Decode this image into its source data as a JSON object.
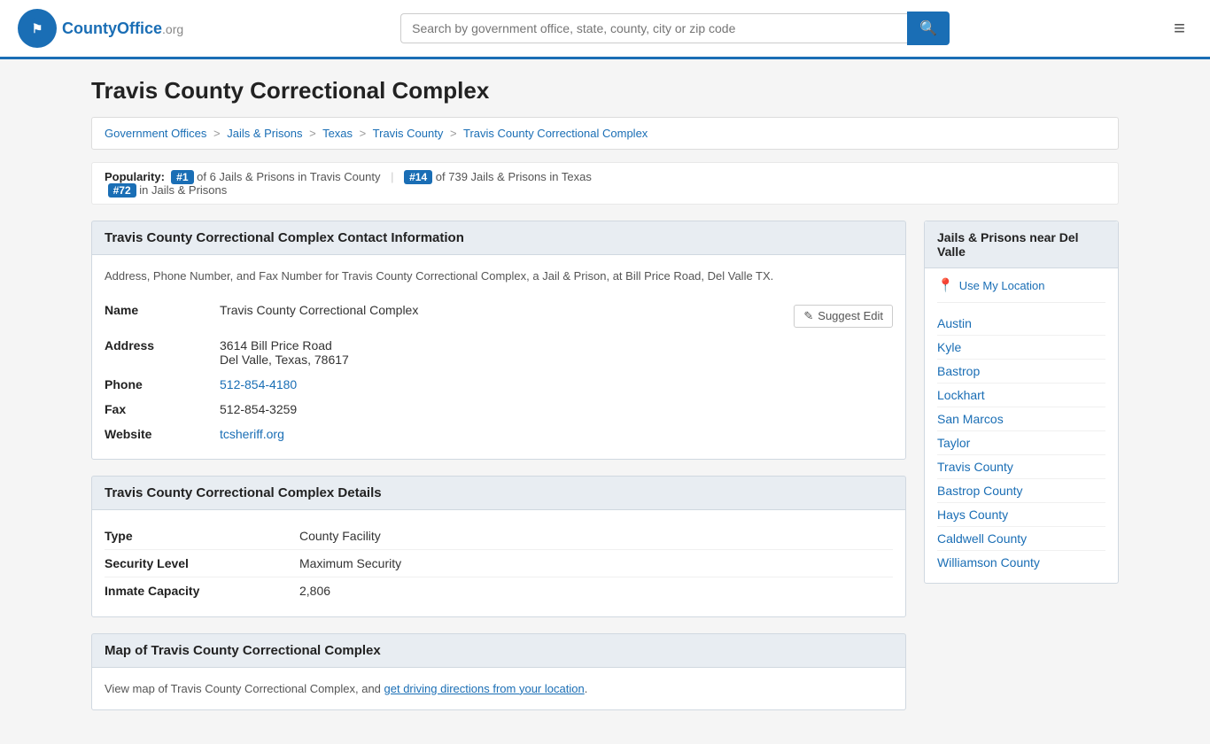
{
  "header": {
    "logo_text": "CountyOffice",
    "logo_org": ".org",
    "search_placeholder": "Search by government office, state, county, city or zip code",
    "search_icon": "🔍",
    "menu_icon": "≡"
  },
  "page": {
    "title": "Travis County Correctional Complex",
    "breadcrumb": {
      "items": [
        {
          "label": "Government Offices",
          "href": "#"
        },
        {
          "label": "Jails & Prisons",
          "href": "#"
        },
        {
          "label": "Texas",
          "href": "#"
        },
        {
          "label": "Travis County",
          "href": "#"
        },
        {
          "label": "Travis County Correctional Complex",
          "href": "#"
        }
      ]
    },
    "popularity": {
      "prefix": "Popularity:",
      "badge1": "#1",
      "of_text1": "of 6 Jails & Prisons in Travis County",
      "badge2": "#14",
      "of_text2": "of 739 Jails & Prisons in Texas",
      "badge3": "#72",
      "of_text3": "in Jails & Prisons"
    }
  },
  "contact_section": {
    "title": "Travis County Correctional Complex Contact Information",
    "description": "Address, Phone Number, and Fax Number for Travis County Correctional Complex, a Jail & Prison, at Bill Price Road, Del Valle TX.",
    "fields": {
      "name_label": "Name",
      "name_value": "Travis County Correctional Complex",
      "address_label": "Address",
      "address_line1": "3614 Bill Price Road",
      "address_line2": "Del Valle, Texas, 78617",
      "phone_label": "Phone",
      "phone_value": "512-854-4180",
      "fax_label": "Fax",
      "fax_value": "512-854-3259",
      "website_label": "Website",
      "website_value": "tcsheriff.org"
    },
    "suggest_edit": "Suggest Edit"
  },
  "details_section": {
    "title": "Travis County Correctional Complex Details",
    "fields": {
      "type_label": "Type",
      "type_value": "County Facility",
      "security_label": "Security Level",
      "security_value": "Maximum Security",
      "capacity_label": "Inmate Capacity",
      "capacity_value": "2,806"
    }
  },
  "map_section": {
    "title": "Map of Travis County Correctional Complex",
    "description": "View map of Travis County Correctional Complex, and ",
    "link_text": "get driving directions from your location",
    "description_end": "."
  },
  "sidebar": {
    "title": "Jails & Prisons near Del Valle",
    "use_location": "Use My Location",
    "links": [
      {
        "label": "Austin",
        "href": "#"
      },
      {
        "label": "Kyle",
        "href": "#"
      },
      {
        "label": "Bastrop",
        "href": "#"
      },
      {
        "label": "Lockhart",
        "href": "#"
      },
      {
        "label": "San Marcos",
        "href": "#"
      },
      {
        "label": "Taylor",
        "href": "#"
      },
      {
        "label": "Travis County",
        "href": "#"
      },
      {
        "label": "Bastrop County",
        "href": "#"
      },
      {
        "label": "Hays County",
        "href": "#"
      },
      {
        "label": "Caldwell County",
        "href": "#"
      },
      {
        "label": "Williamson County",
        "href": "#"
      }
    ]
  }
}
